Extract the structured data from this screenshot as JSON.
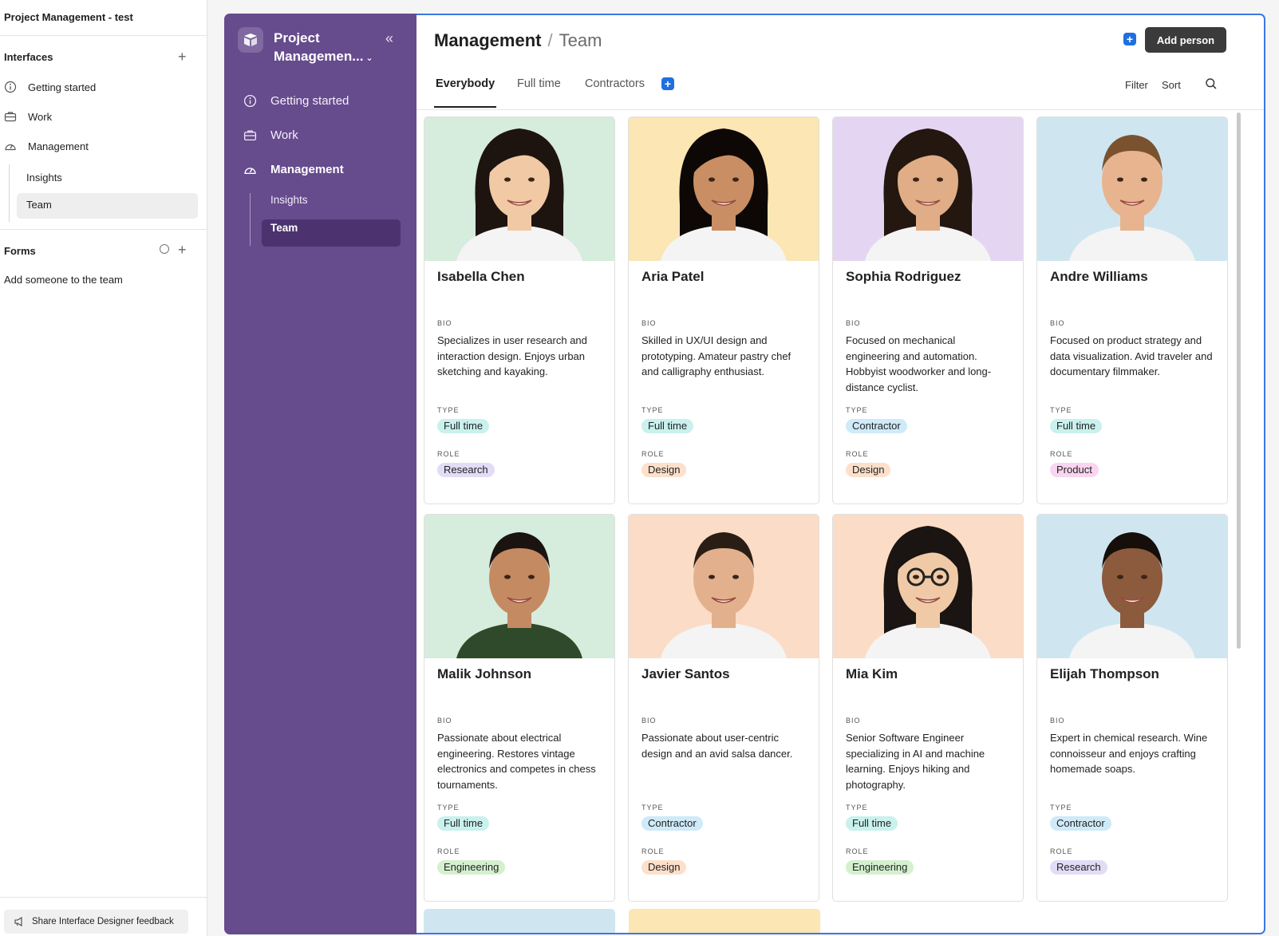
{
  "designer": {
    "project_title": "Project Management - test",
    "interfaces_label": "Interfaces",
    "items": [
      {
        "label": "Getting started",
        "icon": "info-icon"
      },
      {
        "label": "Work",
        "icon": "briefcase-icon"
      },
      {
        "label": "Management",
        "icon": "gauge-icon"
      }
    ],
    "sub_items": [
      "Insights",
      "Team"
    ],
    "forms_label": "Forms",
    "form_items": [
      "Add someone to the team"
    ],
    "feedback_label": "Share Interface Designer feedback"
  },
  "app": {
    "name": "Project Managemen...",
    "nav": [
      {
        "label": "Getting started",
        "icon": "info-icon"
      },
      {
        "label": "Work",
        "icon": "briefcase-icon"
      },
      {
        "label": "Management",
        "icon": "gauge-icon"
      }
    ],
    "sub_nav": [
      "Insights",
      "Team"
    ]
  },
  "page": {
    "breadcrumb_parent": "Management",
    "breadcrumb_sep": "/",
    "breadcrumb_current": "Team",
    "add_button": "Add person",
    "tabs": [
      "Everybody",
      "Full time",
      "Contractors"
    ],
    "filter_label": "Filter",
    "sort_label": "Sort"
  },
  "labels": {
    "bio": "BIO",
    "type": "TYPE",
    "role": "ROLE"
  },
  "people": [
    {
      "name": "Isabella Chen",
      "bio": "Specializes in user research and interaction design. Enjoys urban sketching and kayaking.",
      "type": "Full time",
      "role": "Research",
      "photo_bg": "#d6ecdc"
    },
    {
      "name": "Aria Patel",
      "bio": "Skilled in UX/UI design and prototyping. Amateur pastry chef and calligraphy enthusiast.",
      "type": "Full time",
      "role": "Design",
      "photo_bg": "#fbe6b4"
    },
    {
      "name": "Sophia Rodriguez",
      "bio": "Focused on mechanical engineering and automation. Hobbyist woodworker and long-distance cyclist.",
      "type": "Contractor",
      "role": "Design",
      "photo_bg": "#e4d6f3"
    },
    {
      "name": "Andre Williams",
      "bio": "Focused on product strategy and data visualization. Avid traveler and documentary filmmaker.",
      "type": "Full time",
      "role": "Product",
      "photo_bg": "#cfe6f1"
    },
    {
      "name": "Malik Johnson",
      "bio": "Passionate about electrical engineering. Restores vintage electronics and competes in chess tournaments.",
      "type": "Full time",
      "role": "Engineering",
      "photo_bg": "#d6ecdc"
    },
    {
      "name": "Javier Santos",
      "bio": "Passionate about user-centric design and an avid salsa dancer.",
      "type": "Contractor",
      "role": "Design",
      "photo_bg": "#fbdcc6"
    },
    {
      "name": "Mia Kim",
      "bio": "Senior Software Engineer specializing in AI and machine learning. Enjoys hiking and photography.",
      "type": "Full time",
      "role": "Engineering",
      "photo_bg": "#fbdcc6"
    },
    {
      "name": "Elijah Thompson",
      "bio": "Expert in chemical research. Wine connoisseur and enjoys crafting homemade soaps.",
      "type": "Contractor",
      "role": "Research",
      "photo_bg": "#cfe6f1"
    }
  ],
  "pill_colors": {
    "Full time": "#c9f1ee",
    "Contractor": "#cfeaf8",
    "Research": "#e2dcf7",
    "Design": "#fde0cb",
    "Product": "#f9d5f0",
    "Engineering": "#d4f0cf"
  },
  "colors": {
    "nav_bg": "#664b8d",
    "accent_blue": "#1f6fe0",
    "focus_border": "#3a78e6"
  }
}
